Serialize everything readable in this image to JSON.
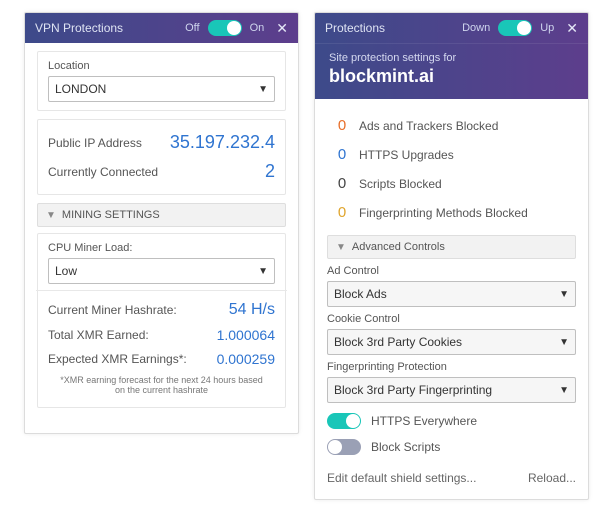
{
  "left": {
    "title": "VPN Protections",
    "off": "Off",
    "on": "On",
    "location_label": "Location",
    "location_value": "LONDON",
    "ip_label": "Public IP Address",
    "ip_value": "35.197.232.4",
    "conn_label": "Currently Connected",
    "conn_value": "2",
    "mining_header": "MINING SETTINGS",
    "cpu_label": "CPU Miner Load:",
    "cpu_value": "Low",
    "hash_label": "Current Miner Hashrate:",
    "hash_value": "54 H/s",
    "total_label": "Total XMR Earned:",
    "total_value": "1.000064",
    "exp_label": "Expected XMR Earnings*:",
    "exp_value": "0.000259",
    "note": "*XMR earning forecast for the next 24 hours based on the current hashrate"
  },
  "right": {
    "title": "Protections",
    "off": "Down",
    "on": "Up",
    "sub1": "Site protection settings for",
    "sub2": "blockmint.ai",
    "items": [
      {
        "count": "0",
        "color": "#e86f2a",
        "label": "Ads and Trackers Blocked"
      },
      {
        "count": "0",
        "color": "#2f74d0",
        "label": "HTTPS Upgrades"
      },
      {
        "count": "0",
        "color": "#444",
        "label": "Scripts Blocked"
      },
      {
        "count": "0",
        "color": "#e0a52d",
        "label": "Fingerprinting Methods Blocked"
      }
    ],
    "adv_header": "Advanced Controls",
    "ad_label": "Ad Control",
    "ad_value": "Block Ads",
    "cookie_label": "Cookie Control",
    "cookie_value": "Block 3rd Party Cookies",
    "fp_label": "Fingerprinting Protection",
    "fp_value": "Block 3rd Party Fingerprinting",
    "https_label": "HTTPS Everywhere",
    "scripts_label": "Block Scripts",
    "foot_left": "Edit default shield settings...",
    "foot_right": "Reload..."
  }
}
